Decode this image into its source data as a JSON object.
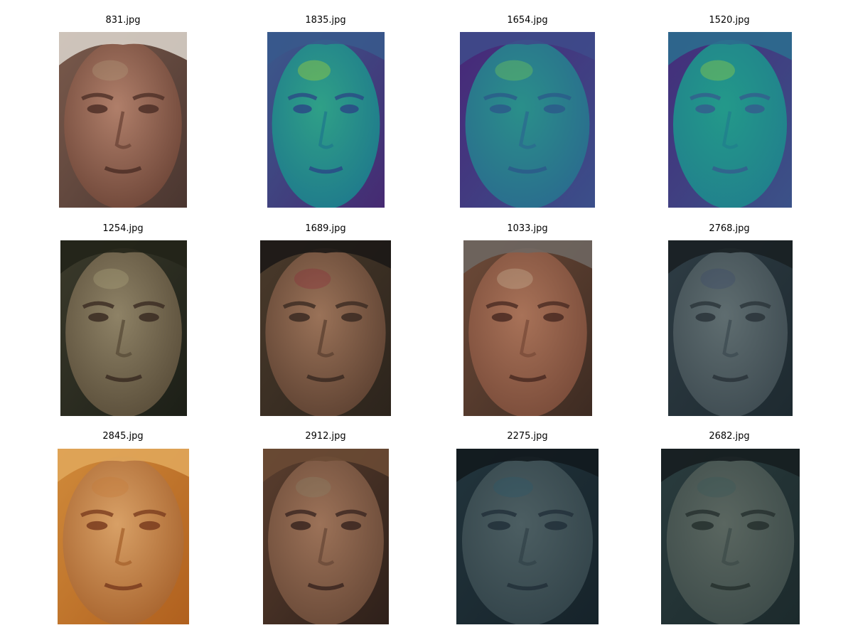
{
  "images": [
    {
      "title": "831.jpg",
      "palette": "photo",
      "colors": {
        "bg": "#4a3630",
        "bg2": "#7a5a4c",
        "skin": "#b07f6a",
        "shade": "#6e4638",
        "hair": "#d7cfc6",
        "feature": "#4d2f27",
        "extra": "#b39a7a"
      }
    },
    {
      "title": "1835.jpg",
      "palette": "viridis",
      "colors": {
        "bg": "#462a72",
        "bg2": "#3a5a8c",
        "skin": "#2fa087",
        "shade": "#1f7a8c",
        "hair": "#38598c",
        "feature": "#2a4a86",
        "extra": "#b8de29"
      }
    },
    {
      "title": "1654.jpg",
      "palette": "viridis",
      "colors": {
        "bg": "#3b4f8a",
        "bg2": "#482777",
        "skin": "#2a8f8a",
        "shade": "#2a6c8e",
        "hair": "#3e4a89",
        "feature": "#2b5b8a",
        "extra": "#7ad151"
      }
    },
    {
      "title": "1520.jpg",
      "palette": "viridis",
      "colors": {
        "bg": "#3b5288",
        "bg2": "#442d7a",
        "skin": "#23998a",
        "shade": "#21808c",
        "hair": "#2c6c8e",
        "feature": "#345e8d",
        "extra": "#a6db36"
      }
    },
    {
      "title": "1254.jpg",
      "palette": "photo",
      "colors": {
        "bg": "#1c1f17",
        "bg2": "#3b3a2b",
        "skin": "#8e8266",
        "shade": "#5a4e3a",
        "hair": "#222418",
        "feature": "#3a2b22",
        "extra": "#b0a57f"
      }
    },
    {
      "title": "1689.jpg",
      "palette": "photo",
      "colors": {
        "bg": "#2c241c",
        "bg2": "#4a3a2b",
        "skin": "#9a7258",
        "shade": "#5e4232",
        "hair": "#1c1816",
        "feature": "#3b2a22",
        "extra": "#8c2a3a"
      }
    },
    {
      "title": "1033.jpg",
      "palette": "photo",
      "colors": {
        "bg": "#3d2b22",
        "bg2": "#6d4a38",
        "skin": "#a87258",
        "shade": "#7a4c3a",
        "hair": "#6e6660",
        "feature": "#4a2a22",
        "extra": "#cbb79a"
      }
    },
    {
      "title": "2768.jpg",
      "palette": "photo",
      "colors": {
        "bg": "#1e2a30",
        "bg2": "#2e3c44",
        "skin": "#5f6d70",
        "shade": "#3f4c52",
        "hair": "#1a2024",
        "feature": "#2a343a",
        "extra": "#3c4a6a"
      }
    },
    {
      "title": "2845.jpg",
      "palette": "photo",
      "colors": {
        "bg": "#b0601e",
        "bg2": "#d08a3a",
        "skin": "#d8a066",
        "shade": "#a8642e",
        "hair": "#e0a65a",
        "feature": "#7a3c1e",
        "extra": "#c77a3a"
      }
    },
    {
      "title": "2912.jpg",
      "palette": "photo",
      "colors": {
        "bg": "#2e201a",
        "bg2": "#5a3e2e",
        "skin": "#9c7258",
        "shade": "#6a4a38",
        "hair": "#6a4a34",
        "feature": "#3a2620",
        "extra": "#8a8066"
      }
    },
    {
      "title": "2275.jpg",
      "palette": "photo",
      "colors": {
        "bg": "#16232a",
        "bg2": "#22343c",
        "skin": "#4c5e62",
        "shade": "#33444a",
        "hair": "#121a1e",
        "feature": "#22303a",
        "extra": "#2a5a6a"
      }
    },
    {
      "title": "2682.jpg",
      "palette": "photo",
      "colors": {
        "bg": "#1c2a2c",
        "bg2": "#2a3c3e",
        "skin": "#5a6660",
        "shade": "#3e4c4a",
        "hair": "#161e20",
        "feature": "#26302e",
        "extra": "#3a5a5a"
      }
    }
  ]
}
